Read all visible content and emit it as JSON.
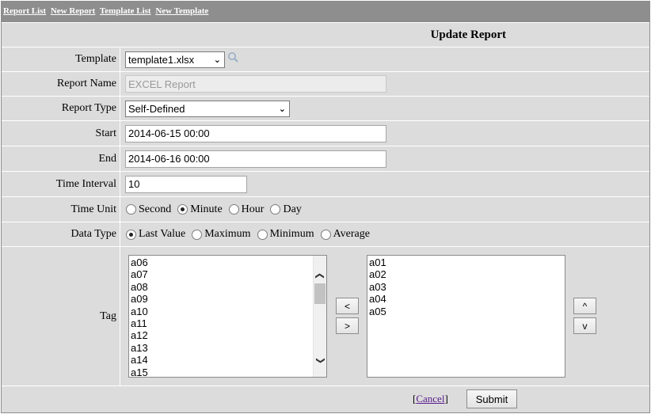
{
  "nav": {
    "links": [
      "Report List",
      "New Report",
      "Template List",
      "New Template"
    ]
  },
  "page": {
    "title": "Update Report"
  },
  "form": {
    "template": {
      "label": "Template",
      "value": "template1.xlsx",
      "icon": "search-icon"
    },
    "report_name": {
      "label": "Report Name",
      "placeholder": "EXCEL Report"
    },
    "report_type": {
      "label": "Report Type",
      "value": "Self-Defined"
    },
    "start": {
      "label": "Start",
      "value": "2014-06-15 00:00"
    },
    "end": {
      "label": "End",
      "value": "2014-06-16 00:00"
    },
    "time_interval": {
      "label": "Time Interval",
      "value": "10"
    },
    "time_unit": {
      "label": "Time Unit",
      "options": [
        "Second",
        "Minute",
        "Hour",
        "Day"
      ],
      "selected": "Minute"
    },
    "data_type": {
      "label": "Data Type",
      "options": [
        "Last Value",
        "Maximum",
        "Minimum",
        "Average"
      ],
      "selected": "Last Value"
    },
    "tag": {
      "label": "Tag",
      "available": [
        "a06",
        "a07",
        "a08",
        "a09",
        "a10",
        "a11",
        "a12",
        "a13",
        "a14",
        "a15"
      ],
      "selected": [
        "a01",
        "a02",
        "a03",
        "a04",
        "a05"
      ],
      "move_left": "<",
      "move_right": ">",
      "move_up": "^",
      "move_down": "v"
    }
  },
  "footer": {
    "cancel": "Cancel",
    "submit": "Submit"
  }
}
